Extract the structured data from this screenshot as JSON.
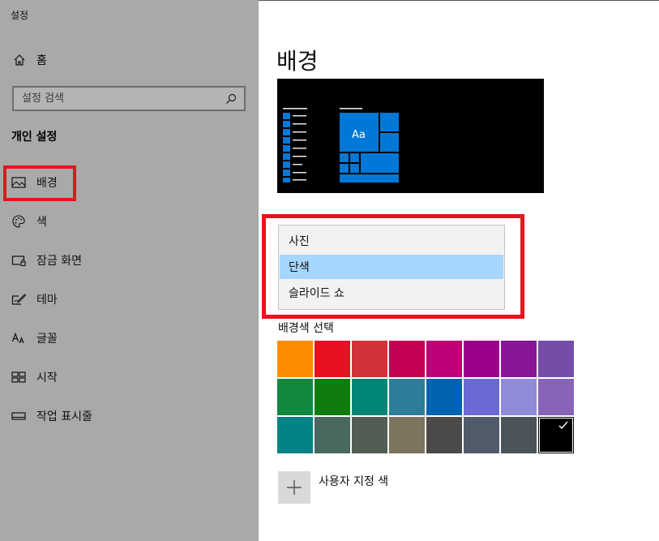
{
  "app": {
    "title": "설정"
  },
  "sidebar": {
    "home_label": "홈",
    "search_placeholder": "설정 검색",
    "section_title": "개인 설정",
    "items": [
      {
        "label": "배경",
        "icon": "picture-icon",
        "active": true
      },
      {
        "label": "색",
        "icon": "palette-icon"
      },
      {
        "label": "잠금 화면",
        "icon": "lock-screen-icon"
      },
      {
        "label": "테마",
        "icon": "theme-brush-icon"
      },
      {
        "label": "글꼴",
        "icon": "font-icon"
      },
      {
        "label": "시작",
        "icon": "start-grid-icon"
      },
      {
        "label": "작업 표시줄",
        "icon": "taskbar-icon"
      }
    ]
  },
  "main": {
    "title": "배경",
    "preview_tile_text": "Aa",
    "dropdown": {
      "options": [
        "사진",
        "단색",
        "슬라이드 쇼"
      ],
      "selected": "단색"
    },
    "color_section_label": "배경색 선택",
    "colors": [
      "#ff8c00",
      "#e81123",
      "#d13438",
      "#c30052",
      "#bf0077",
      "#9a0089",
      "#881798",
      "#744da9",
      "#10893e",
      "#107c10",
      "#018574",
      "#2d7d9a",
      "#0063b1",
      "#6b69d6",
      "#8e8cd8",
      "#8764b8",
      "#038387",
      "#486860",
      "#525e54",
      "#7e735f",
      "#4c4a48",
      "#515c6b",
      "#4a5459",
      "#000000"
    ],
    "selected_color": "#000000",
    "custom_color_label": "사용자 지정 색"
  },
  "accent": {
    "highlight": "#e8141c",
    "preview_tile": "#0078d7",
    "selection": "#a6d6fd"
  }
}
